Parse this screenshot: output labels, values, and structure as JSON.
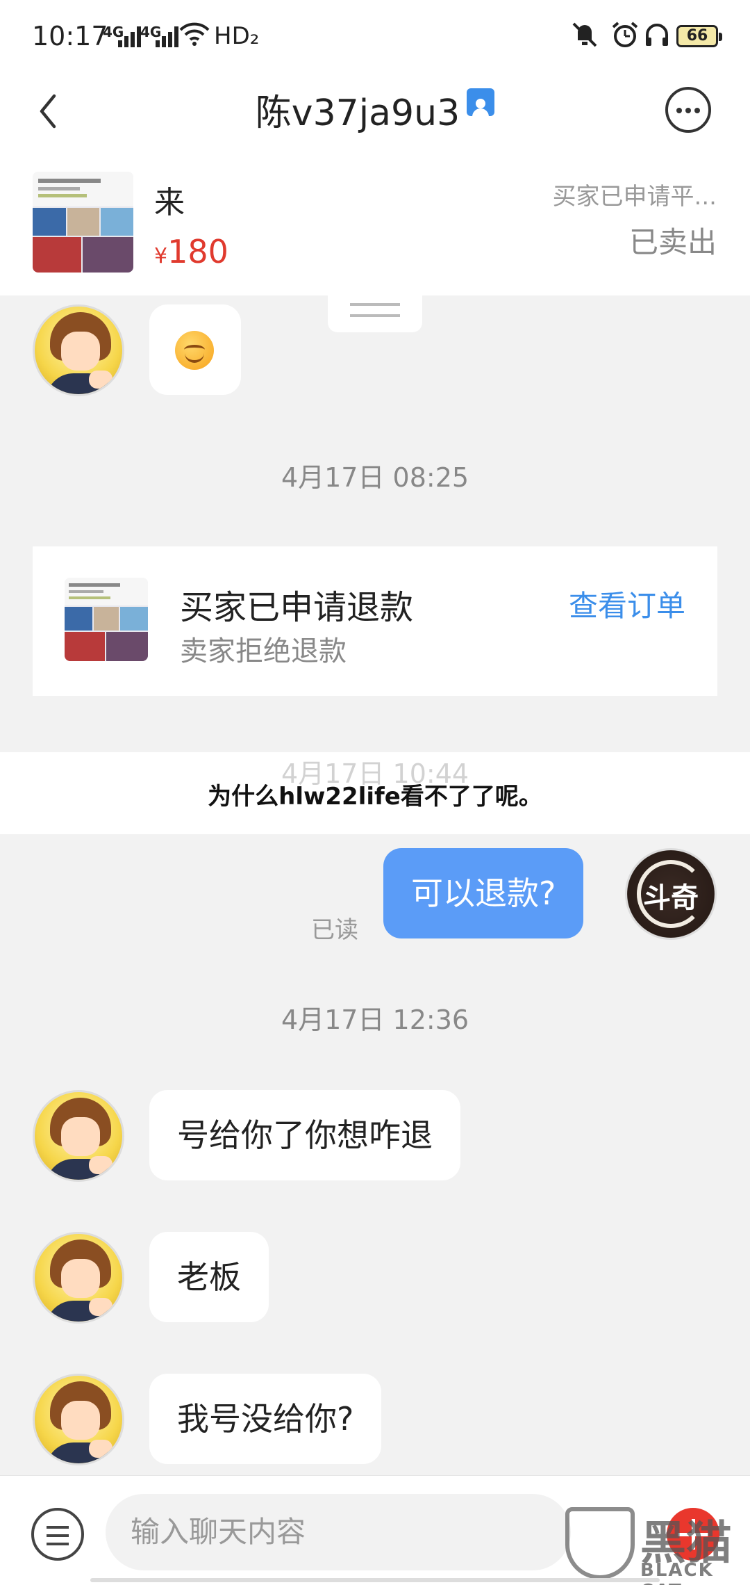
{
  "status_bar": {
    "time": "10:17",
    "network_1": "4G",
    "network_2": "4G",
    "hd": "HD₂",
    "battery": "66"
  },
  "header": {
    "title": "陈v37ja9u3"
  },
  "product": {
    "name": "来",
    "currency": "¥",
    "price": "180",
    "status": "买家已申请平...",
    "sold_label": "已卖出"
  },
  "chat": {
    "timestamp_1": "4月17日 08:25",
    "order_card": {
      "title": "买家已申请退款",
      "subtitle": "卖家拒绝退款",
      "link": "查看订单"
    },
    "timestamp_2_partial": "4月17日 10:44",
    "banner_text": "为什么hlw22life看不了了呢。",
    "my_message": "可以退款?",
    "read_label": "已读",
    "my_avatar_text": "斗奇",
    "timestamp_3": "4月17日 12:36",
    "messages": [
      "号给你了你想咋退",
      "老板",
      "我号没给你?"
    ]
  },
  "composer": {
    "placeholder": "输入聊天内容"
  },
  "watermark": {
    "title": "黑猫",
    "subtitle": "BLACK CAT"
  },
  "colors": {
    "accent_blue": "#3b8eea",
    "bubble_blue": "#5b9cf7",
    "price_red": "#e03a2e",
    "plus_red": "#e9372d"
  }
}
